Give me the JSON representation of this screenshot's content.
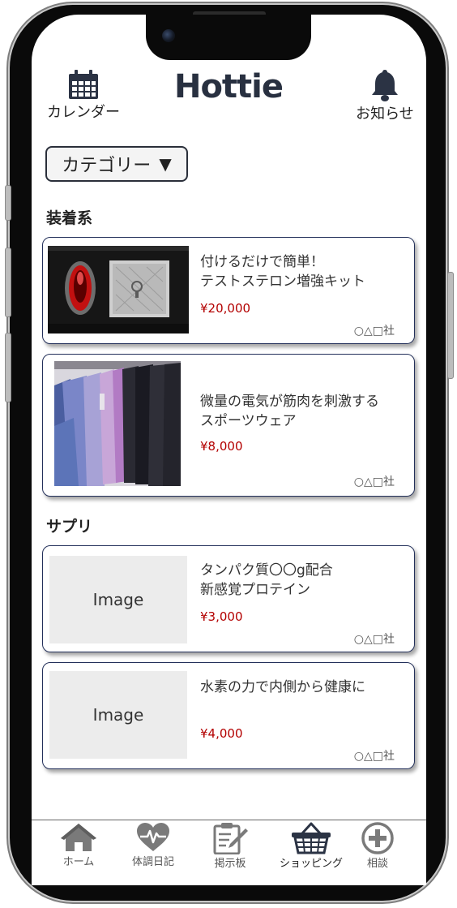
{
  "app": {
    "logo": "Hottie"
  },
  "header": {
    "calendar_label": "カレンダー",
    "notice_label": "お知らせ"
  },
  "category_button": {
    "label": "カテゴリー",
    "arrow": "▼"
  },
  "sections": [
    {
      "title": "装着系",
      "products": [
        {
          "title": "付けるだけで簡単！\nテストステロン増強キット",
          "price": "¥20,000",
          "maker": "○△□社",
          "image": "photo"
        },
        {
          "title": "微量の電気が筋肉を刺激する\nスポーツウェア",
          "price": "¥8,000",
          "maker": "○△□社",
          "image": "photo"
        }
      ]
    },
    {
      "title": "サプリ",
      "products": [
        {
          "title": "タンパク質〇〇g配合\n新感覚プロテイン",
          "price": "¥3,000",
          "maker": "○△□社",
          "image_placeholder": "Image"
        },
        {
          "title": "水素の力で内側から健康に",
          "price": "¥4,000",
          "maker": "○△□社",
          "image_placeholder": "Image"
        }
      ]
    }
  ],
  "tabbar": {
    "items": [
      {
        "label": "ホーム",
        "icon": "home-icon",
        "active": false
      },
      {
        "label": "体調日記",
        "icon": "heart-pulse-icon",
        "active": false
      },
      {
        "label": "掲示板",
        "icon": "notepad-pencil-icon",
        "active": false
      },
      {
        "label": "ショッピング",
        "icon": "basket-icon",
        "active": true
      },
      {
        "label": "相談",
        "icon": "plus-circle-icon",
        "active": false
      }
    ]
  },
  "colors": {
    "accent_dark": "#23305a",
    "price_red": "#b30000",
    "icon_dark": "#2b3344",
    "icon_gray": "#7a7a7a"
  }
}
